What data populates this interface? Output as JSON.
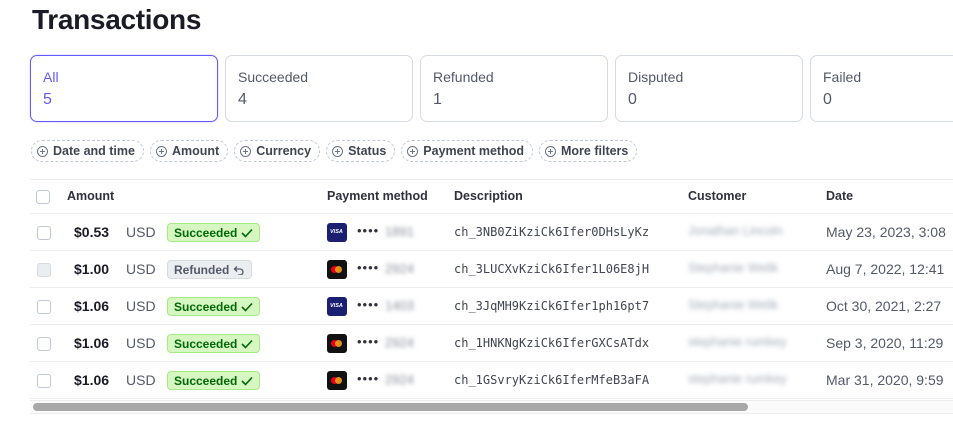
{
  "page": {
    "title": "Transactions"
  },
  "tabs": [
    {
      "label": "All",
      "count": "5"
    },
    {
      "label": "Succeeded",
      "count": "4"
    },
    {
      "label": "Refunded",
      "count": "1"
    },
    {
      "label": "Disputed",
      "count": "0"
    },
    {
      "label": "Failed",
      "count": "0"
    }
  ],
  "filters": [
    "Date and time",
    "Amount",
    "Currency",
    "Status",
    "Payment method",
    "More filters"
  ],
  "columns": {
    "amount": "Amount",
    "payment_method": "Payment method",
    "description": "Description",
    "customer": "Customer",
    "date": "Date"
  },
  "rows": [
    {
      "amount": "$0.53",
      "currency": "USD",
      "status": "Succeeded",
      "card": "VISA",
      "dots": "••••",
      "last4": "1891",
      "description": "ch_3NB0ZiKziCk6Ifer0DHsLyKz",
      "customer": "Jonathan Lincoln",
      "date": "May 23, 2023, 3:08"
    },
    {
      "amount": "$1.00",
      "currency": "USD",
      "status": "Refunded",
      "card": "mastercard",
      "dots": "••••",
      "last4": "2924",
      "description": "ch_3LUCXvKziCk6Ifer1L06E8jH",
      "customer": "Stephanie Welik",
      "date": "Aug 7, 2022, 12:41"
    },
    {
      "amount": "$1.06",
      "currency": "USD",
      "status": "Succeeded",
      "card": "VISA",
      "dots": "••••",
      "last4": "1403",
      "description": "ch_3JqMH9KziCk6Ifer1ph16pt7",
      "customer": "Stephanie Welik",
      "date": "Oct 30, 2021, 2:27"
    },
    {
      "amount": "$1.06",
      "currency": "USD",
      "status": "Succeeded",
      "card": "mastercard",
      "dots": "••••",
      "last4": "2924",
      "description": "ch_1HNKNgKziCk6IferGXCsATdx",
      "customer": "stephanie rumkey",
      "date": "Sep 3, 2020, 11:29"
    },
    {
      "amount": "$1.06",
      "currency": "USD",
      "status": "Succeeded",
      "card": "mastercard",
      "dots": "••••",
      "last4": "2924",
      "description": "ch_1GSvryKziCk6IferMfeB3aFA",
      "customer": "stephanie rumkey",
      "date": "Mar 31, 2020, 9:59"
    }
  ],
  "icons": {
    "succeeded": "check-icon",
    "refunded": "undo-arrow-icon",
    "filter": "plus-circle-icon"
  },
  "colors": {
    "accent": "#635bff",
    "success_bg": "#d7f7c2",
    "success_text": "#006908"
  }
}
